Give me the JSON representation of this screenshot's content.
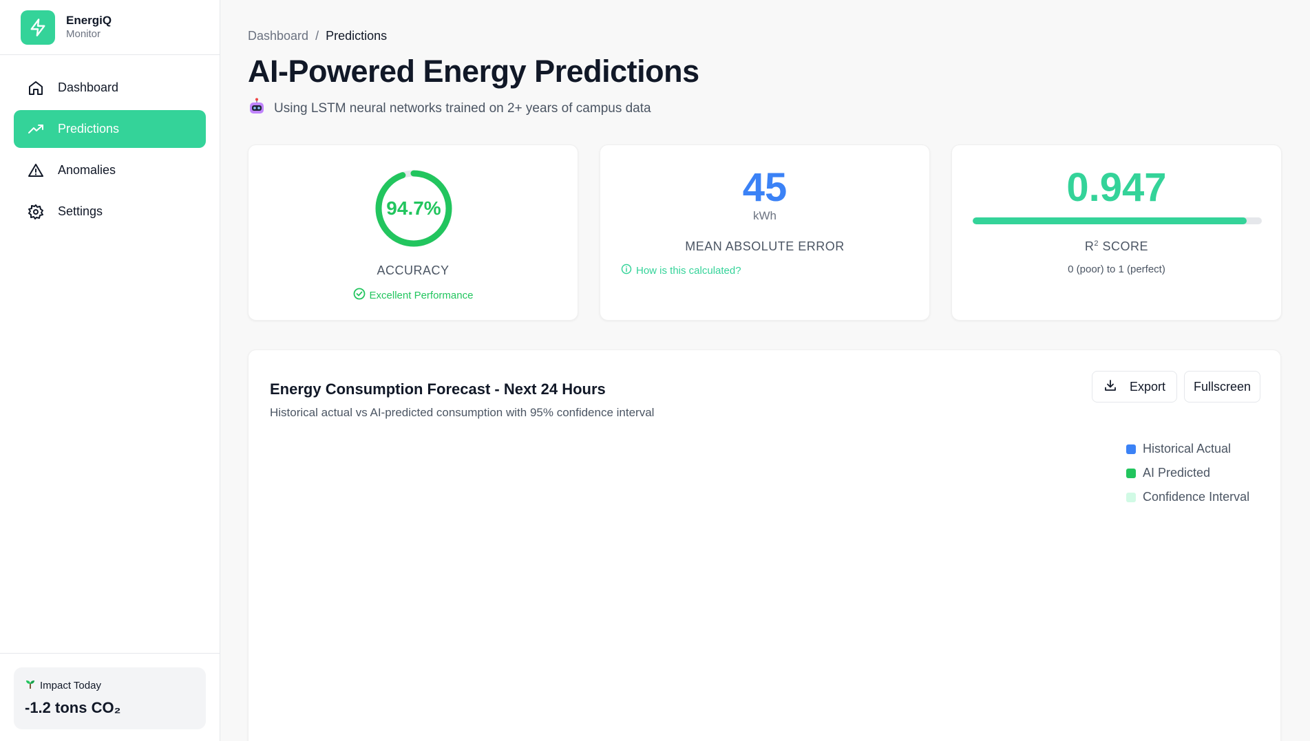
{
  "brand": {
    "name": "EnergiQ",
    "sub": "Monitor"
  },
  "sidebar": {
    "items": [
      {
        "label": "Dashboard",
        "icon": "home-icon",
        "active": false
      },
      {
        "label": "Predictions",
        "icon": "trending-up-icon",
        "active": true
      },
      {
        "label": "Anomalies",
        "icon": "alert-triangle-icon",
        "active": false
      },
      {
        "label": "Settings",
        "icon": "gear-icon",
        "active": false
      }
    ],
    "impact": {
      "title": "Impact Today",
      "icon": "seedling-icon",
      "value": "-1.2 tons CO₂"
    }
  },
  "breadcrumb": {
    "root": "Dashboard",
    "separator": "/",
    "current": "Predictions"
  },
  "page": {
    "title": "AI-Powered Energy Predictions",
    "subtitle": "Using LSTM neural networks trained on 2+ years of campus data",
    "subtitle_icon": "robot-icon"
  },
  "metrics": {
    "accuracy": {
      "value": "94.7%",
      "fraction": 0.947,
      "label": "ACCURACY",
      "note": "Excellent Performance"
    },
    "mae": {
      "value": "45",
      "unit": "kWh",
      "label": "MEAN ABSOLUTE ERROR",
      "link": "How is this calculated?"
    },
    "r2": {
      "value": "0.947",
      "fraction": 0.947,
      "label_main": "R",
      "label_sup": "2",
      "label_rest": " SCORE",
      "note": "0 (poor) to 1 (perfect)"
    }
  },
  "chart": {
    "title": "Energy Consumption Forecast - Next 24 Hours",
    "subtitle": "Historical actual vs AI-predicted consumption with 95% confidence interval",
    "export_label": "Export",
    "fullscreen_label": "Fullscreen",
    "legend": [
      {
        "label": "Historical Actual",
        "color": "#3b82f6"
      },
      {
        "label": "AI Predicted",
        "color": "#22c55e"
      },
      {
        "label": "Confidence Interval",
        "color": "#d1fae5"
      }
    ]
  },
  "colors": {
    "accent": "#34d399",
    "green": "#22c55e",
    "blue": "#3b82f6"
  }
}
